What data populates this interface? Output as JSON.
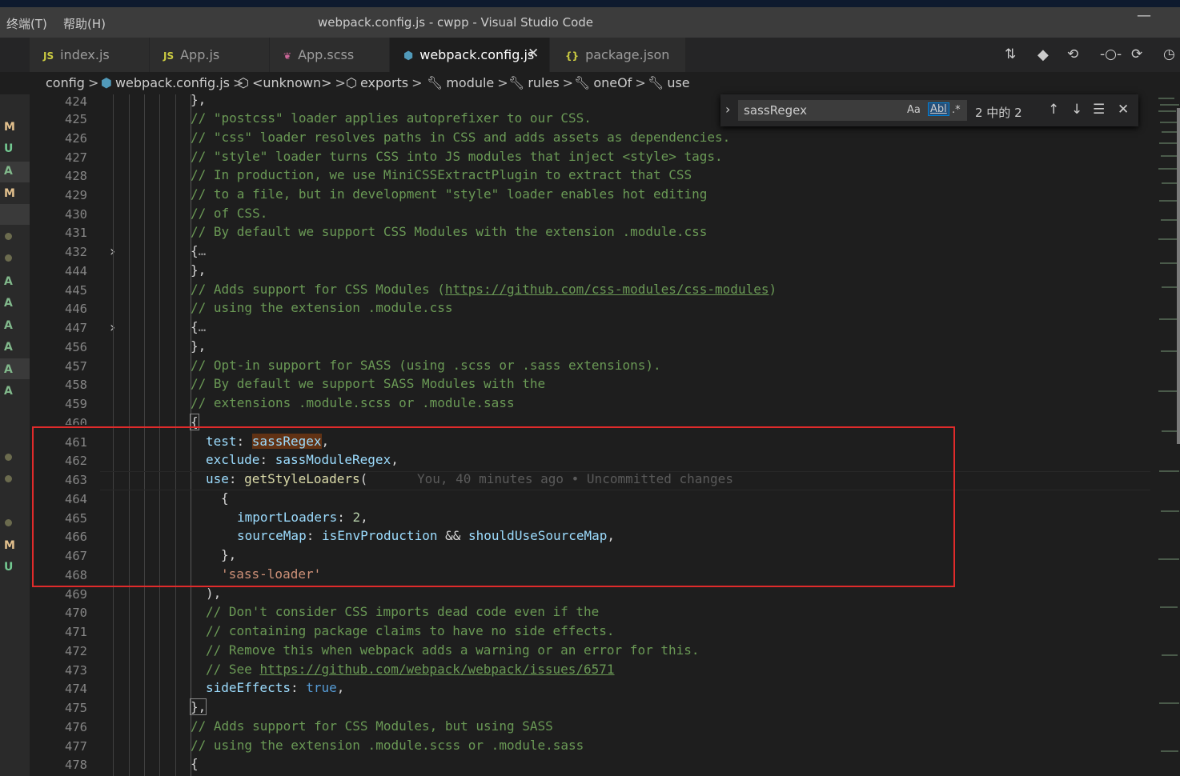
{
  "window": {
    "menu": [
      "终端(T)",
      "帮助(H)"
    ],
    "title": "webpack.config.js - cwpp - Visual Studio Code",
    "minimize_glyph": "—"
  },
  "tabs": [
    {
      "icon": "JS",
      "label": "index.js",
      "color": "#cbcb41"
    },
    {
      "icon": "JS",
      "label": "App.js",
      "color": "#cbcb41"
    },
    {
      "icon": "",
      "label": "App.scss",
      "color": "#cd6799"
    },
    {
      "icon": "",
      "label": "webpack.config.js",
      "color": "#519aba",
      "active": true,
      "close": "✕"
    },
    {
      "icon": "{}",
      "label": "package.json",
      "color": "#cbcb41"
    }
  ],
  "actions": [
    "compare-icon",
    "source-control-icon",
    "go-back-icon",
    "commit-icon",
    "go-forward-icon",
    "timeline-icon"
  ],
  "breadcrumbs": [
    "config",
    "webpack.config.js",
    "<unknown>",
    "exports",
    "module",
    "rules",
    "oneOf",
    "use"
  ],
  "find_widget": {
    "query": "sassRegex",
    "opt_case": "Aa",
    "opt_word": "Abl",
    "opt_regex": ".*",
    "count": "2 中的 2"
  },
  "scm_decorations": [
    "M",
    "U",
    "A",
    "M",
    "A",
    "A",
    "A",
    "A",
    "A",
    "A",
    "M",
    "U"
  ],
  "line_numbers": [
    "424",
    "425",
    "426",
    "427",
    "428",
    "429",
    "430",
    "431",
    "432",
    "444",
    "445",
    "446",
    "447",
    "456",
    "457",
    "458",
    "459",
    "460",
    "461",
    "462",
    "463",
    "464",
    "465",
    "466",
    "467",
    "468",
    "469",
    "470",
    "471",
    "472",
    "473",
    "474",
    "475",
    "476",
    "477",
    "478"
  ],
  "code_text": {
    "l424": "},",
    "l425": "// \"postcss\" loader applies autoprefixer to our CSS.",
    "l426": "// \"css\" loader resolves paths in CSS and adds assets as dependencies.",
    "l427": "// \"style\" loader turns CSS into JS modules that inject <style> tags.",
    "l428": "// In production, we use MiniCSSExtractPlugin to extract that CSS",
    "l429": "// to a file, but in development \"style\" loader enables hot editing",
    "l430": "// of CSS.",
    "l431": "// By default we support CSS Modules with the extension .module.css",
    "l432": "{",
    "ellipsis": "…",
    "l444": "},",
    "l445_a": "// Adds support for CSS Modules (",
    "l445_url": "https://github.com/css-modules/css-modules",
    "l445_b": ")",
    "l446": "// using the extension .module.css",
    "l447": "{",
    "l456": "},",
    "l457": "// Opt-in support for SASS (using .scss or .sass extensions).",
    "l458": "// By default we support SASS Modules with the",
    "l459": "// extensions .module.scss or .module.sass",
    "l460": "{",
    "l461_key": "test",
    "l461_val": "sassRegex",
    "l462_key": "exclude",
    "l462_val": "sassModuleRegex",
    "l463_key": "use",
    "l463_fn": "getStyleLoaders",
    "l463_blame": "You, 40 minutes ago • Uncommitted changes",
    "l464": "{",
    "l465_key": "importLoaders",
    "l465_val": "2",
    "l466_key": "sourceMap",
    "l466_a": "isEnvProduction",
    "l466_op": "&&",
    "l466_b": "shouldUseSourceMap",
    "l467": "},",
    "l468": "'sass-loader'",
    "l469": "),",
    "l470": "// Don't consider CSS imports dead code even if the",
    "l471": "// containing package claims to have no side effects.",
    "l472": "// Remove this when webpack adds a warning or an error for this.",
    "l473_a": "// See ",
    "l473_url": "https://github.com/webpack/webpack/issues/6571",
    "l474_key": "sideEffects",
    "l474_val": "true",
    "l475": "},",
    "l476": "// Adds support for CSS Modules, but using SASS",
    "l477": "// using the extension .module.scss or .module.sass",
    "l478": "{"
  }
}
